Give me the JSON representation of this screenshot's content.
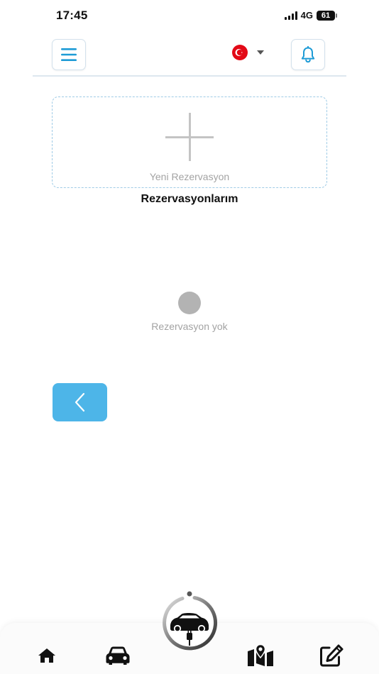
{
  "status_bar": {
    "time": "17:45",
    "network": "4G",
    "battery": "61"
  },
  "header": {
    "menu_icon": "hamburger-menu-icon",
    "language_flag": "turkey-flag",
    "language_dropdown_icon": "caret-down-icon",
    "notification_icon": "bell-icon"
  },
  "new_reservation": {
    "icon": "plus-icon",
    "label": "Yeni Rezervasyon"
  },
  "section_title": "Rezervasyonlarım",
  "empty_state": {
    "message": "Rezervasyon yok"
  },
  "back_button": {
    "icon": "chevron-left-icon"
  },
  "bottom_nav": {
    "items": [
      {
        "icon": "home-icon"
      },
      {
        "icon": "car-icon"
      },
      {
        "icon": "ev-charging-logo-icon"
      },
      {
        "icon": "map-pin-icon"
      },
      {
        "icon": "edit-icon"
      }
    ]
  },
  "colors": {
    "accent": "#4db5e8",
    "icon_blue": "#1d9bd6",
    "card_border": "#9fcbe6",
    "muted_text": "#a3a3a3",
    "flag_red": "#e30a17"
  }
}
